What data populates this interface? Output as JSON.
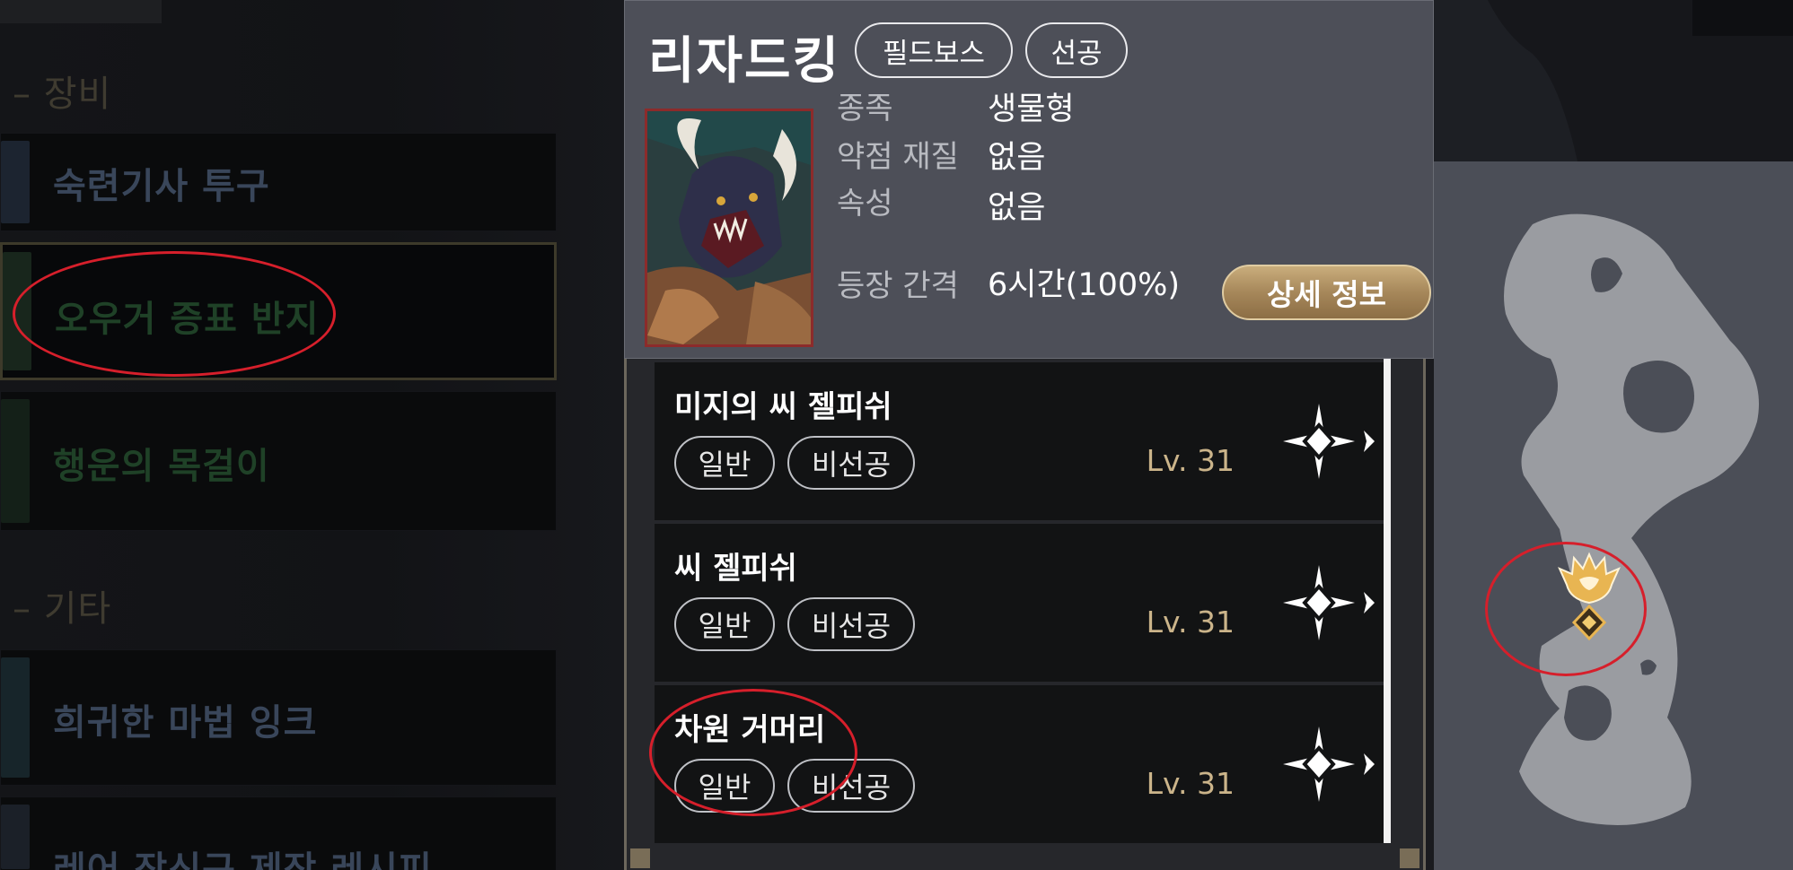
{
  "left": {
    "sections": [
      {
        "label": "– 장비"
      },
      {
        "label": "– 기타"
      }
    ],
    "items": [
      {
        "name": "숙련기사 투구"
      },
      {
        "name": "오우거 증표 반지"
      },
      {
        "name": "행운의 목걸이"
      },
      {
        "name": "희귀한 마법 잉크"
      },
      {
        "name": "레어 장신구 제작 레시피"
      }
    ]
  },
  "boss": {
    "name": "리자드킹",
    "tags": [
      "필드보스",
      "선공"
    ],
    "attributes": [
      {
        "label": "종족",
        "value": "생물형"
      },
      {
        "label": "약점 재질",
        "value": "없음"
      },
      {
        "label": "속성",
        "value": "없음"
      },
      {
        "label": "등장 간격",
        "value": "6시간(100%)"
      }
    ],
    "detail_button": "상세 정보"
  },
  "monsters": [
    {
      "name": "미지의 씨 젤피쉬",
      "tags": [
        "일반",
        "비선공"
      ],
      "level": "Lv. 31"
    },
    {
      "name": "씨 젤피쉬",
      "tags": [
        "일반",
        "비선공"
      ],
      "level": "Lv. 31"
    },
    {
      "name": "차원 거머리",
      "tags": [
        "일반",
        "비선공"
      ],
      "level": "Lv. 31"
    }
  ],
  "colors": {
    "annotation": "#d61f2b",
    "level_text": "#cbb48a",
    "panel_bg": "#4d4f58",
    "button_gold": "#b0925f",
    "map_land": "#9a9ca1",
    "boss_marker": "#e8b552"
  }
}
